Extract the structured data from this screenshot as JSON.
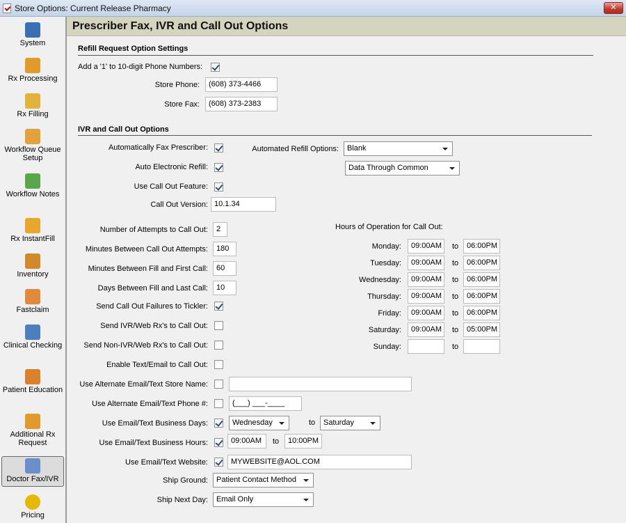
{
  "window": {
    "title": "Store Options: Current Release Pharmacy",
    "close_label": "✕"
  },
  "sidebar": {
    "items": [
      {
        "label": "System",
        "icon": "computer-icon",
        "color": "#3a6fb5"
      },
      {
        "label": "Rx Processing",
        "icon": "rx-bottle-icon",
        "color": "#e29a2a"
      },
      {
        "label": "Rx Filling",
        "icon": "pill-bottle-icon",
        "color": "#e2b33a"
      },
      {
        "label": "Workflow Queue Setup",
        "icon": "workflow-queue-icon",
        "color": "#e2a23a"
      },
      {
        "label": "Workflow Notes",
        "icon": "notes-icon",
        "color": "#5aa64b"
      },
      {
        "label": "Rx InstantFill",
        "icon": "instantfill-icon",
        "color": "#e8a72c"
      },
      {
        "label": "Inventory",
        "icon": "inventory-icon",
        "color": "#d08a2a"
      },
      {
        "label": "Fastclaim",
        "icon": "fastclaim-icon",
        "color": "#e08a3a"
      },
      {
        "label": "Clinical Checking",
        "icon": "book-icon",
        "color": "#4b7fc0"
      },
      {
        "label": "Patient Education",
        "icon": "patient-icon",
        "color": "#d9822b"
      },
      {
        "label": "Additional Rx Request",
        "icon": "request-icon",
        "color": "#e29a2a"
      },
      {
        "label": "Doctor Fax/IVR",
        "icon": "doctor-icon",
        "color": "#6a8fc9"
      },
      {
        "label": "Pricing",
        "icon": "coin-icon",
        "color": "#e6b800"
      }
    ]
  },
  "page": {
    "title": "Prescriber Fax, IVR and Call Out Options"
  },
  "refill": {
    "section_title": "Refill Request Option Settings",
    "add_one_label": "Add a '1' to 10-digit Phone Numbers:",
    "add_one_checked": true,
    "store_phone_label": "Store Phone:",
    "store_phone": "(608) 373-4466",
    "store_fax_label": "Store Fax:",
    "store_fax": "(608) 373-2383"
  },
  "ivr": {
    "section_title": "IVR and Call Out Options",
    "auto_fax_label": "Automatically Fax Prescriber:",
    "auto_fax": true,
    "auto_erefill_label": "Auto Electronic Refill:",
    "auto_erefill": true,
    "use_callout_label": "Use Call Out Feature:",
    "use_callout": true,
    "callout_version_label": "Call Out Version:",
    "callout_version": "10.1.34",
    "automated_refill_label": "Automated Refill Options:",
    "automated_refill_value": "Blank",
    "data_source_value": "Data Through Common",
    "attempts_label": "Number of Attempts to Call Out:",
    "attempts": "2",
    "minutes_between_label": "Minutes Between Call Out Attempts:",
    "minutes_between": "180",
    "fill_first_label": "Minutes Between Fill and First Call:",
    "fill_first": "60",
    "fill_last_label": "Days Between Fill and Last Call:",
    "fill_last": "10",
    "failures_label": "Send Call Out Failures to Tickler:",
    "failures": true,
    "send_ivr_label": "Send IVR/Web Rx's to Call Out:",
    "send_ivr": false,
    "send_non_ivr_label": "Send Non-IVR/Web Rx's to Call Out:",
    "send_non_ivr": false,
    "enable_text_label": "Enable Text/Email to Call Out:",
    "enable_text": false,
    "alt_name_label": "Use Alternate Email/Text Store Name:",
    "alt_name": false,
    "alt_name_value": "",
    "alt_phone_label": "Use Alternate Email/Text Phone #:",
    "alt_phone": false,
    "alt_phone_value": "(___) ___-____",
    "biz_days_label": "Use Email/Text Business Days:",
    "biz_days": true,
    "biz_days_from": "Wednesday",
    "biz_days_to_label": "to",
    "biz_days_to": "Saturday",
    "biz_hours_label": "Use Email/Text Business Hours:",
    "biz_hours": true,
    "biz_hours_from": "09:00AM",
    "biz_hours_to_label": "to",
    "biz_hours_to": "10:00PM",
    "website_label": "Use Email/Text Website:",
    "website": true,
    "website_value": "MYWEBSITE@AOL.COM",
    "ship_ground_label": "Ship Ground:",
    "ship_ground": "Patient Contact Method",
    "ship_next_label": "Ship Next Day:",
    "ship_next": "Email Only"
  },
  "hours": {
    "title": "Hours of Operation for Call Out:",
    "to_label": "to",
    "days": [
      {
        "day": "Monday:",
        "from": "09:00AM",
        "to": "06:00PM"
      },
      {
        "day": "Tuesday:",
        "from": "09:00AM",
        "to": "06:00PM"
      },
      {
        "day": "Wednesday:",
        "from": "09:00AM",
        "to": "06:00PM"
      },
      {
        "day": "Thursday:",
        "from": "09:00AM",
        "to": "06:00PM"
      },
      {
        "day": "Friday:",
        "from": "09:00AM",
        "to": "06:00PM"
      },
      {
        "day": "Saturday:",
        "from": "09:00AM",
        "to": "05:00PM"
      },
      {
        "day": "Sunday:",
        "from": "",
        "to": ""
      }
    ]
  }
}
